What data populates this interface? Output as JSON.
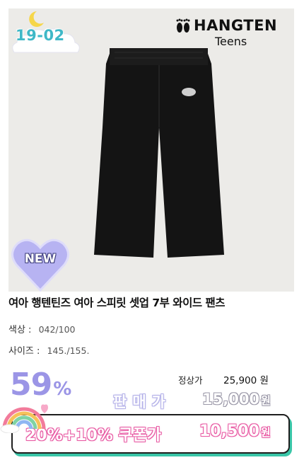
{
  "product": {
    "tag": "19-02",
    "brand": {
      "name": "HANGTEN",
      "sub": "Teens"
    },
    "badge": "NEW",
    "title": "여아 행텐틴즈 여아 스피릿 셋업 7부 와이드 팬츠",
    "specs": {
      "color_label": "색상 :",
      "color_value": "042/100",
      "size_label": "사이즈 :",
      "size_value": "145./155."
    }
  },
  "pricing": {
    "discount_value": "59",
    "discount_unit": "%",
    "regular_label": "정상가",
    "regular_price": "25,900 원",
    "sale_label": "판매가",
    "sale_price": "15,000",
    "sale_unit": "원",
    "coupon_label": "20%+10% 쿠폰가",
    "coupon_price": "10,500",
    "coupon_unit": "원"
  },
  "colors": {
    "accent_purple": "#9b95e6",
    "accent_pink": "#e85aa3",
    "accent_teal": "#3ac6a8",
    "tag_blue": "#3fb8c7"
  },
  "icons": [
    "moon-cloud-icon",
    "feet-logo-icon",
    "heart-new-icon",
    "rainbow-cloud-icon",
    "pants-image"
  ]
}
